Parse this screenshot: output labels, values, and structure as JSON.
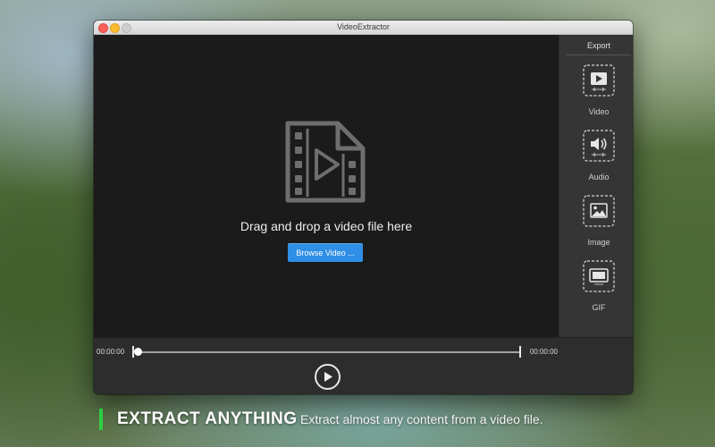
{
  "window": {
    "title": "VideoExtractor"
  },
  "dropzone": {
    "prompt": "Drag and drop a video file here",
    "browse_label": "Browse Video ..."
  },
  "sidebar": {
    "title": "Export",
    "items": [
      {
        "label": "Video",
        "icon": "video-export-icon"
      },
      {
        "label": "Audio",
        "icon": "audio-export-icon"
      },
      {
        "label": "Image",
        "icon": "image-export-icon"
      },
      {
        "label": "GIF",
        "icon": "gif-export-icon"
      }
    ]
  },
  "timeline": {
    "start_time": "00:00:00",
    "end_time": "00:00:00",
    "playhead_fraction": 0
  },
  "tagline": {
    "title": "EXTRACT ANYTHING",
    "subtitle": "Extract almost any content from a video file."
  },
  "colors": {
    "accent": "#2f8ee6",
    "tagline_bar": "#2ecc40"
  }
}
